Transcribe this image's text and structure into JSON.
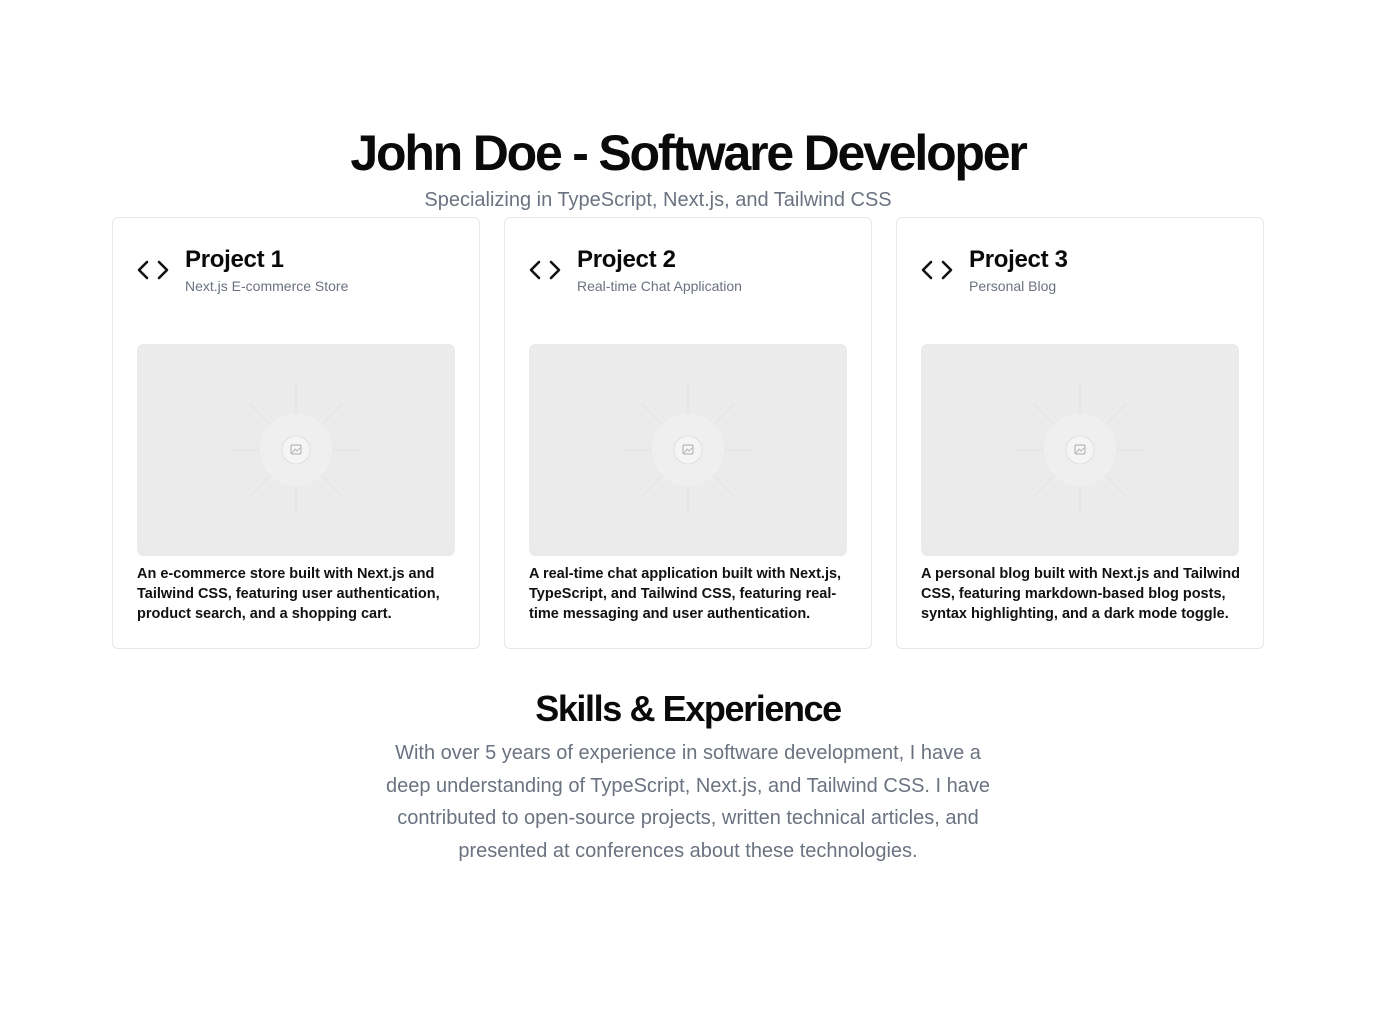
{
  "hero": {
    "title": "John Doe - Software Developer",
    "subtitle": "Specializing in TypeScript, Next.js, and Tailwind CSS"
  },
  "projects": [
    {
      "title": "Project 1",
      "subtitle": "Next.js E-commerce Store",
      "icon": "code-icon",
      "image": "image-placeholder",
      "description": "An e-commerce store built with Next.js and Tailwind CSS, featuring user authentication, product search, and a shopping cart."
    },
    {
      "title": "Project 2",
      "subtitle": "Real-time Chat Application",
      "icon": "code-icon",
      "image": "image-placeholder",
      "description": "A real-time chat application built with Next.js, TypeScript, and Tailwind CSS, featuring real-time messaging and user authentication."
    },
    {
      "title": "Project 3",
      "subtitle": "Personal Blog",
      "icon": "code-icon",
      "image": "image-placeholder",
      "description": "A personal blog built with Next.js and Tailwind CSS, featuring markdown-based blog posts, syntax highlighting, and a dark mode toggle."
    }
  ],
  "skills": {
    "title": "Skills & Experience",
    "body": "With over 5 years of experience in software development, I have a deep understanding of TypeScript, Next.js, and Tailwind CSS. I have contributed to open-source projects, written technical articles, and presented at conferences about these technologies."
  },
  "colors": {
    "text": "#0a0a0a",
    "muted": "#6b7280",
    "border": "#e5e7eb",
    "placeholder_bg": "#ebebeb"
  }
}
